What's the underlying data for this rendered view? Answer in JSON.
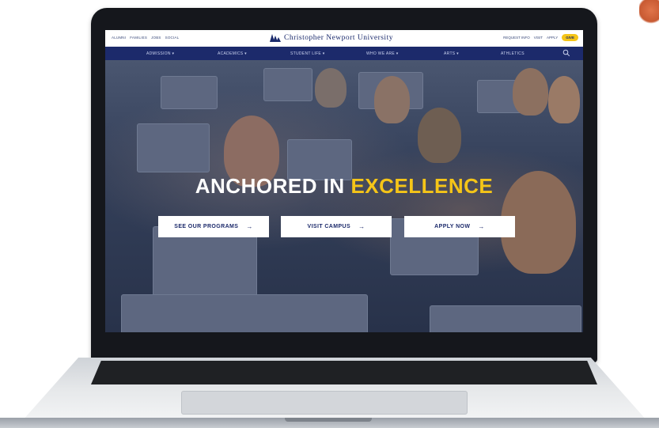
{
  "utility_bar": {
    "links": [
      "ALUMNI",
      "FAMILIES",
      "JOBS",
      "SOCIAL"
    ],
    "brand_name": "Christopher Newport University",
    "right_links": [
      "REQUEST INFO",
      "VISIT",
      "APPLY"
    ],
    "give_label": "GIVE"
  },
  "main_nav": {
    "items": [
      "ADMISSION ▾",
      "ACADEMICS ▾",
      "STUDENT LIFE ▾",
      "WHO WE ARE ▾",
      "ARTS ▾",
      "ATHLETICS"
    ]
  },
  "hero": {
    "headline_part1": "ANCHORED IN",
    "headline_part2": "EXCELLENCE",
    "cta": [
      {
        "label": "SEE OUR PROGRAMS",
        "arrow": "→"
      },
      {
        "label": "VISIT CAMPUS",
        "arrow": "→"
      },
      {
        "label": "APPLY NOW",
        "arrow": "→"
      }
    ]
  },
  "colors": {
    "navy": "#1c2a6b",
    "gold": "#f5c518",
    "white": "#ffffff"
  },
  "icons": {
    "search": "search-icon"
  }
}
